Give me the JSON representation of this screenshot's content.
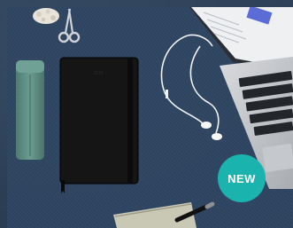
{
  "badge": {
    "label": "NEW",
    "color": "#1bb3ad"
  },
  "notebook": {
    "color": "#111111",
    "elastic_band": "#0c0c0c"
  },
  "pencil_case": {
    "color": "#5f9185"
  },
  "background": {
    "color": "#2e435a"
  }
}
